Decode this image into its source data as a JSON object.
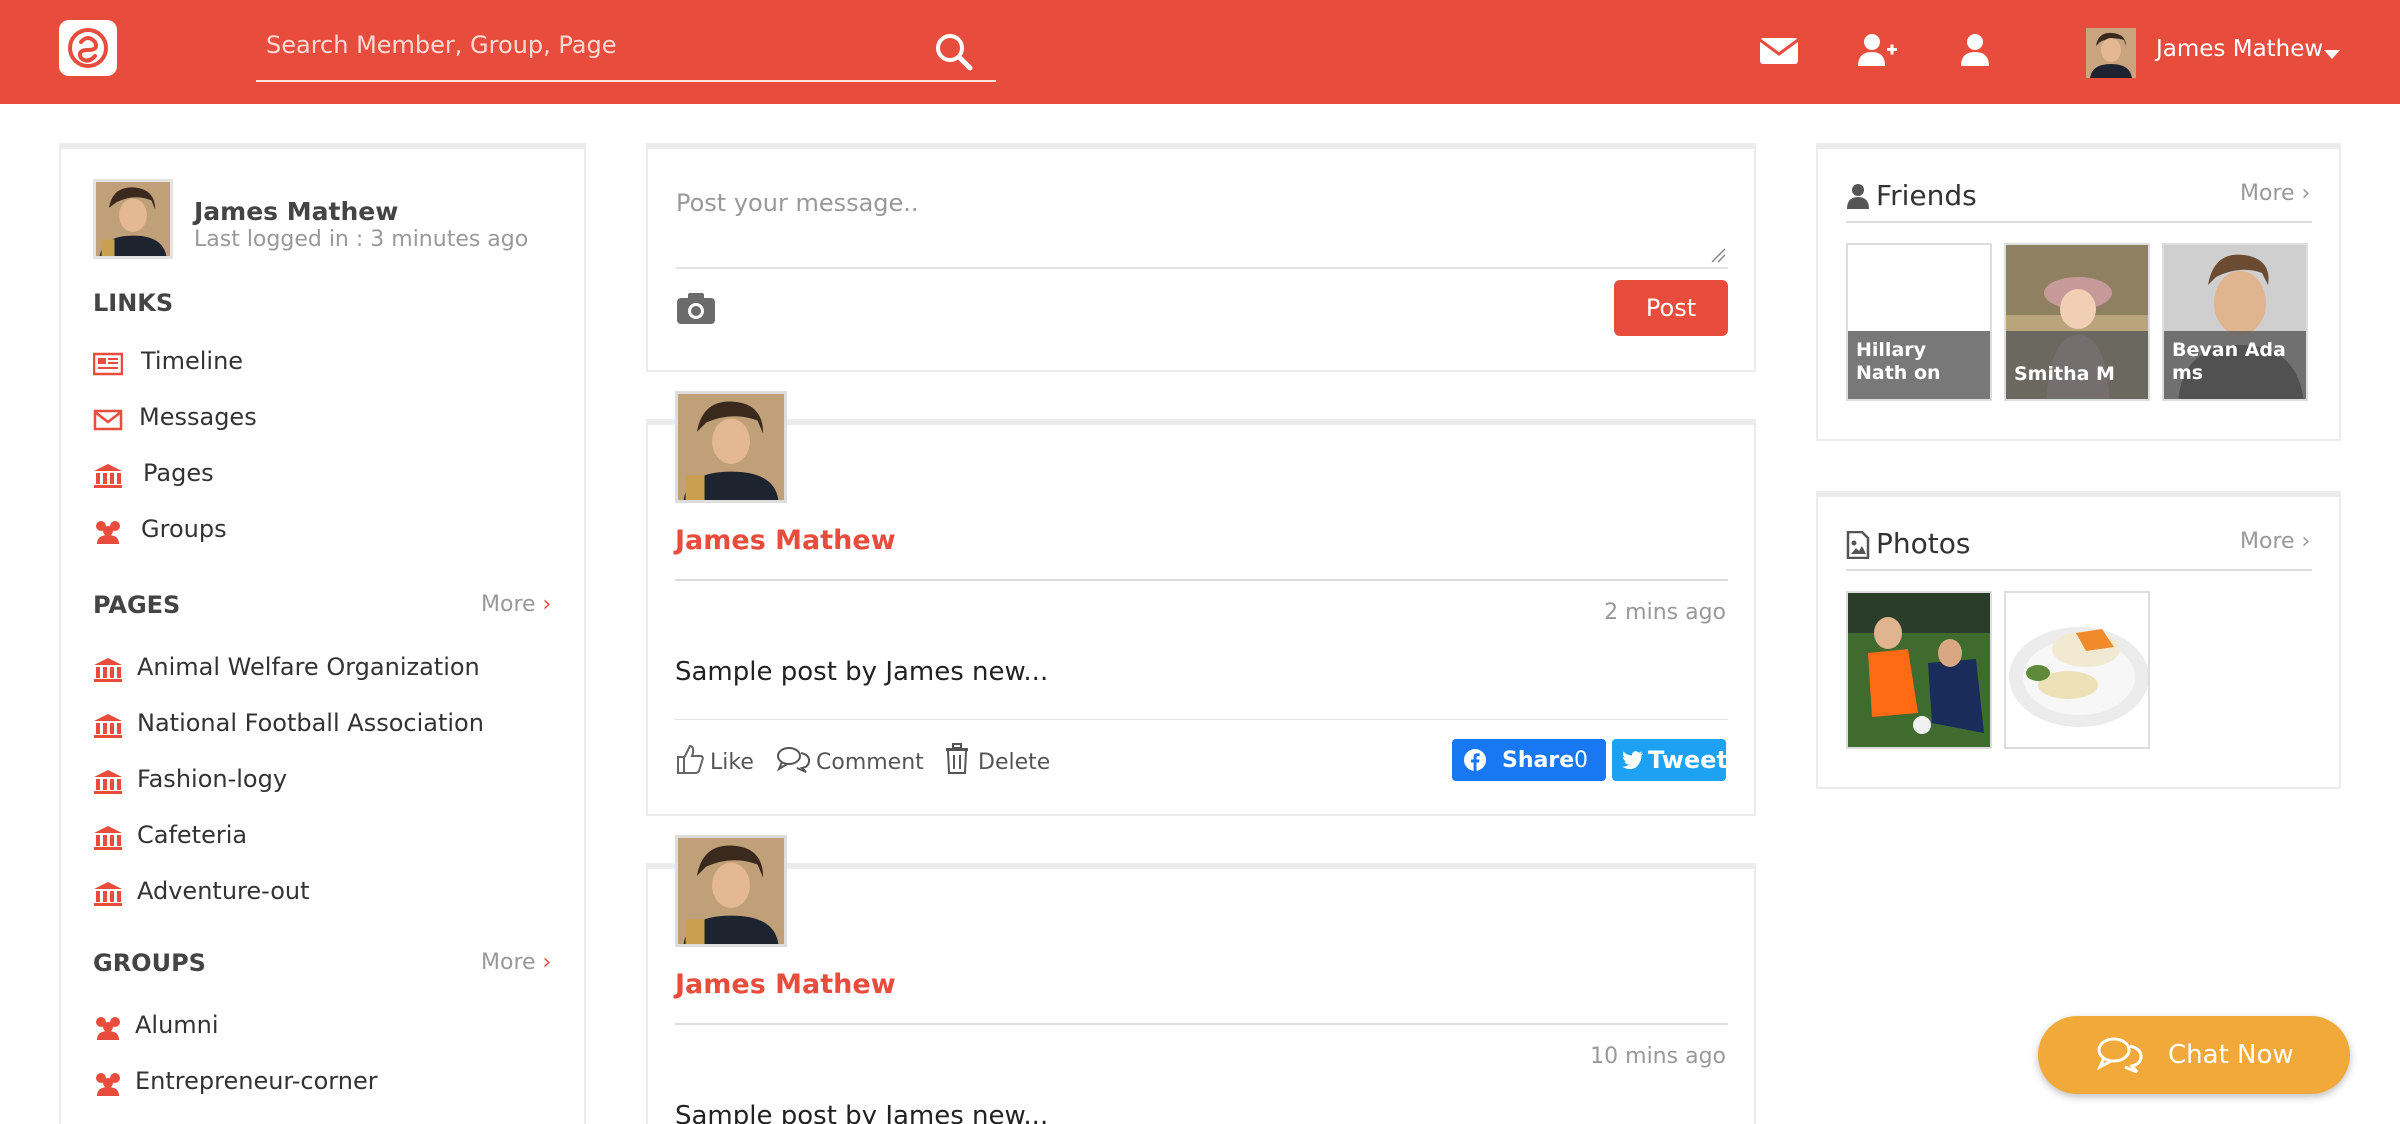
{
  "header": {
    "search_placeholder": "Search Member, Group, Page",
    "user_name": "James Mathew"
  },
  "profile": {
    "name": "James Mathew",
    "last_login": "Last logged in : 3 minutes ago"
  },
  "links": {
    "title": "LINKS",
    "items": [
      {
        "label": "Timeline",
        "icon": "newspaper-icon"
      },
      {
        "label": "Messages",
        "icon": "envelope-icon"
      },
      {
        "label": "Pages",
        "icon": "bank-icon"
      },
      {
        "label": "Groups",
        "icon": "users-icon"
      }
    ]
  },
  "pages": {
    "title": "PAGES",
    "more": "More",
    "items": [
      "Animal Welfare Organization",
      "National Football Association",
      "Fashion-logy",
      "Cafeteria",
      "Adventure-out"
    ]
  },
  "groups": {
    "title": "GROUPS",
    "more": "More",
    "items": [
      "Alumni",
      "Entrepreneur-corner"
    ]
  },
  "composer": {
    "placeholder": "Post your message..",
    "post_label": "Post"
  },
  "posts": [
    {
      "author": "James Mathew",
      "time": "2 mins ago",
      "text": "Sample post by James new...",
      "like": "Like",
      "comment": "Comment",
      "delete": "Delete",
      "share_label": "Share",
      "share_count": "0",
      "tweet_label": "Tweet"
    },
    {
      "author": "James Mathew",
      "time": "10 mins ago",
      "text": "Sample post by James new..."
    }
  ],
  "friends": {
    "title": "Friends",
    "more": "More",
    "items": [
      "Hillary Nath on",
      "Smitha M",
      "Bevan Ada ms"
    ]
  },
  "photos": {
    "title": "Photos",
    "more": "More"
  },
  "chat": {
    "label": "Chat Now"
  },
  "colors": {
    "accent": "#e74c3c",
    "chat": "#f1a93a",
    "facebook": "#1877f2",
    "twitter": "#1da1f2"
  }
}
